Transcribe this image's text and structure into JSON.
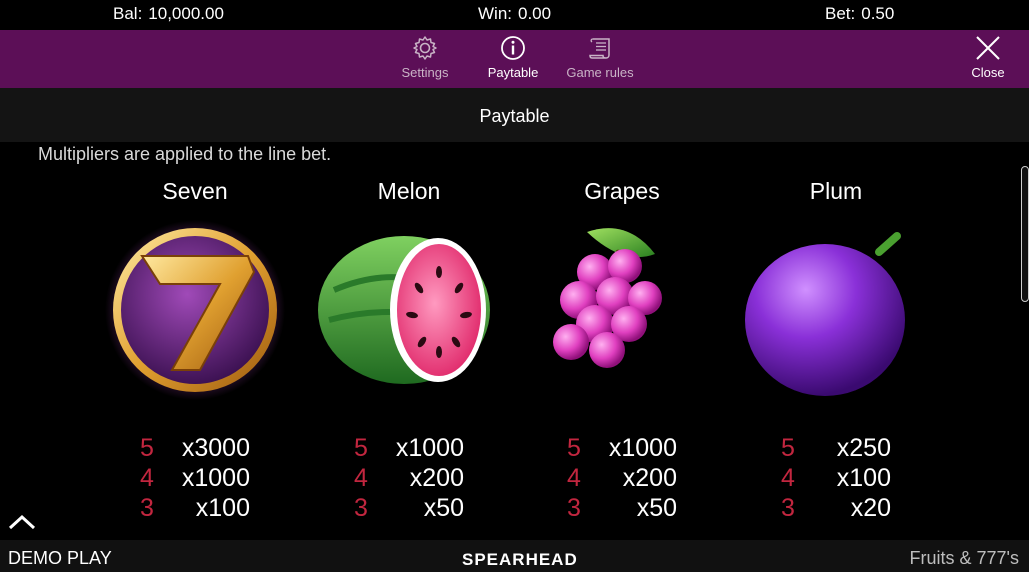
{
  "status": {
    "balance_label": "Bal:",
    "balance_value": "10,000.00",
    "win_label": "Win:",
    "win_value": "0.00",
    "bet_label": "Bet:",
    "bet_value": "0.50"
  },
  "menu": {
    "settings_label": "Settings",
    "paytable_label": "Paytable",
    "rules_label": "Game rules",
    "close_label": "Close",
    "active": "Paytable"
  },
  "page": {
    "title": "Paytable",
    "intro": "Multipliers are applied to the line bet."
  },
  "symbols": [
    {
      "name": "Seven",
      "icon": "seven-icon",
      "pays": [
        {
          "count": "5",
          "mult": "x3000"
        },
        {
          "count": "4",
          "mult": "x1000"
        },
        {
          "count": "3",
          "mult": "x100"
        }
      ]
    },
    {
      "name": "Melon",
      "icon": "melon-icon",
      "pays": [
        {
          "count": "5",
          "mult": "x1000"
        },
        {
          "count": "4",
          "mult": "x200"
        },
        {
          "count": "3",
          "mult": "x50"
        }
      ]
    },
    {
      "name": "Grapes",
      "icon": "grapes-icon",
      "pays": [
        {
          "count": "5",
          "mult": "x1000"
        },
        {
          "count": "4",
          "mult": "x200"
        },
        {
          "count": "3",
          "mult": "x50"
        }
      ]
    },
    {
      "name": "Plum",
      "icon": "plum-icon",
      "pays": [
        {
          "count": "5",
          "mult": "x250"
        },
        {
          "count": "4",
          "mult": "x100"
        },
        {
          "count": "3",
          "mult": "x20"
        }
      ]
    }
  ],
  "footer": {
    "mode": "DEMO PLAY",
    "brand": "SPEARHEAD",
    "game": "Fruits & 777's"
  },
  "colors": {
    "menu_bar": "#5c0f57",
    "count_red": "#c2263f",
    "background": "#000000"
  }
}
